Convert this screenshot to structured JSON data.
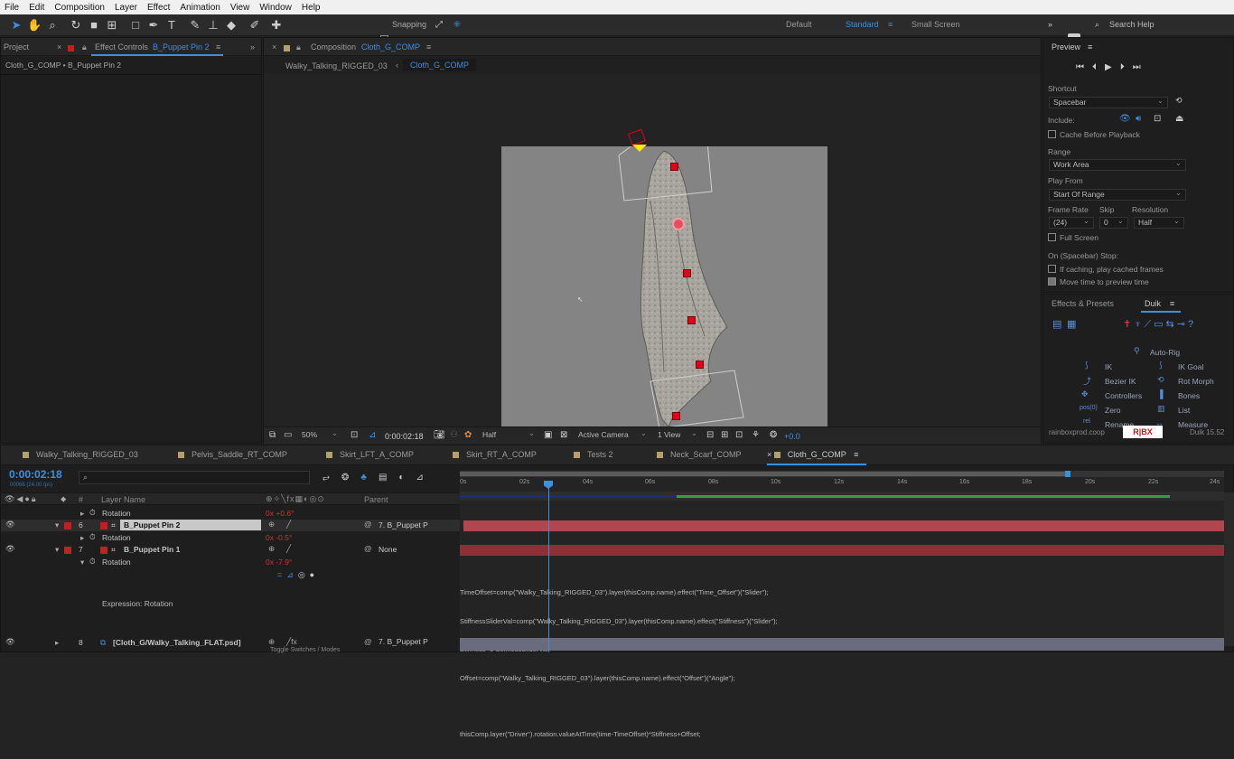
{
  "menu": [
    "File",
    "Edit",
    "Composition",
    "Layer",
    "Effect",
    "Animation",
    "View",
    "Window",
    "Help"
  ],
  "toolbar": {
    "snapping": "Snapping",
    "workspaces": [
      "Default",
      "Standard",
      "Small Screen"
    ],
    "search_placeholder": "Search Help"
  },
  "left_panel": {
    "tab_project": "Project",
    "tab_effect_controls": "Effect Controls",
    "effect_target": "B_Puppet Pin 2",
    "breadcrumb": "Cloth_G_COMP • B_Puppet Pin 2"
  },
  "comp_panel": {
    "tab_label": "Composition",
    "comp_name": "Cloth_G_COMP",
    "crumb1": "Walky_Talking_RIGGED_03",
    "crumb2": "Cloth_G_COMP",
    "footer": {
      "zoom": "50%",
      "timecode": "0:00:02:18",
      "resolution": "Half",
      "camera": "Active Camera",
      "view": "1 View",
      "exposure": "+0.0"
    }
  },
  "preview": {
    "title": "Preview",
    "shortcut_label": "Shortcut",
    "shortcut_value": "Spacebar",
    "include_label": "Include:",
    "cache_before": "Cache Before Playback",
    "range_label": "Range",
    "range_value": "Work Area",
    "play_from_label": "Play From",
    "play_from_value": "Start Of Range",
    "frame_rate_label": "Frame Rate",
    "skip_label": "Skip",
    "resolution_label": "Resolution",
    "frame_rate_value": "(24)",
    "skip_value": "0",
    "resolution_value": "Half",
    "full_screen": "Full Screen",
    "on_stop": "On (Spacebar) Stop:",
    "if_caching": "If caching, play cached frames",
    "move_time": "Move time to preview time"
  },
  "duik": {
    "tab_effects": "Effects & Presets",
    "tab_duik": "Duik",
    "auto_rig": "Auto-Rig",
    "ik": "IK",
    "ik_goal": "IK Goal",
    "bezier_ik": "Bezier IK",
    "rot_morph": "Rot Morph",
    "controllers": "Controllers",
    "bones": "Bones",
    "zero": "Zero",
    "list": "List",
    "rename": "Rename",
    "measure": "Measure",
    "footer_left": "rainboxprod.coop",
    "footer_right": "Duik 15.52"
  },
  "timeline": {
    "tabs": [
      "Walky_Talking_RIGGED_03",
      "Pelvis_Saddle_RT_COMP",
      "Skirt_LFT_A_COMP",
      "Skirt_RT_A_COMP",
      "Tests 2",
      "Neck_Scarf_COMP",
      "Cloth_G_COMP"
    ],
    "timecode": "0:00:02:18",
    "fps": "00066 (24.00 fps)",
    "search_placeholder": "",
    "col_layer_name": "Layer Name",
    "col_parent": "Parent",
    "ruler": [
      "0s",
      "02s",
      "04s",
      "06s",
      "08s",
      "10s",
      "12s",
      "14s",
      "16s",
      "18s",
      "20s",
      "22s",
      "24s"
    ],
    "rows": [
      {
        "kind": "prop",
        "label": "Rotation",
        "value": "0x +0.6°"
      },
      {
        "kind": "layer",
        "num": "6",
        "name": "B_Puppet Pin 2",
        "parent": "7. B_Puppet P"
      },
      {
        "kind": "prop",
        "label": "Rotation",
        "value": "0x -0.5°"
      },
      {
        "kind": "layer",
        "num": "7",
        "name": "B_Puppet Pin 1",
        "parent": "None"
      },
      {
        "kind": "prop",
        "label": "Rotation",
        "value": "0x -7.9°"
      }
    ],
    "expression_label": "Expression: Rotation",
    "expression_lines": [
      "TimeOffset=comp(\"Walky_Talking_RIGGED_03\").layer(thisComp.name).effect(\"Time_Offset\")(\"Slider\");",
      "StiffnessSliderVal=comp(\"Walky_Talking_RIGGED_03\").layer(thisComp.name).effect(\"Stiffness\")(\"Slider\");",
      "Stiffness=1-StiffnessSliderVal;",
      "Offset=comp(\"Walky_Talking_RIGGED_03\").layer(thisComp.name).effect(\"Offset\")(\"Angle\");",
      "",
      "thisComp.layer(\"Driver\").rotation.valueAtTime(time-TimeOffset)*Stiffness+Offset;"
    ],
    "bottom_layer": {
      "num": "8",
      "name": "[Cloth_G/Walky_Talking_FLAT.psd]",
      "parent": "7. B_Puppet P"
    },
    "toggle_label": "Toggle Switches / Modes"
  }
}
